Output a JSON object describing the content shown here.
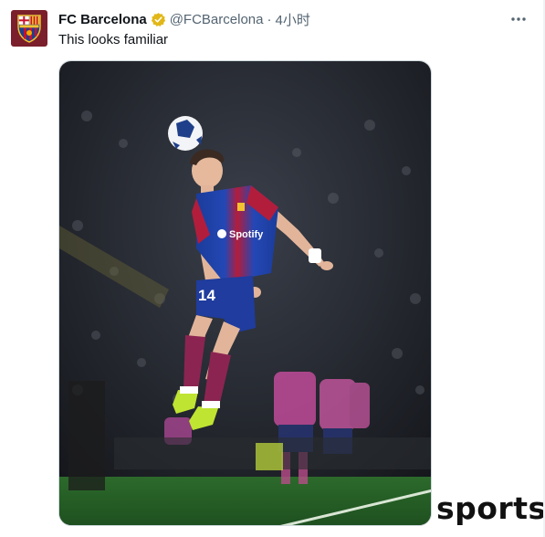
{
  "tweet": {
    "author_name": "FC Barcelona",
    "handle": "@FCBarcelona",
    "separator": "·",
    "time": "4小时",
    "text": "This looks familiar",
    "verified_color": "#e2b719"
  },
  "media": {
    "jersey_sponsor": "Spotify",
    "player_number": "14"
  },
  "watermark": "sports",
  "colors": {
    "avatar_bg": "#7a1f2b",
    "text_primary": "#0f1419",
    "text_secondary": "#536471"
  }
}
